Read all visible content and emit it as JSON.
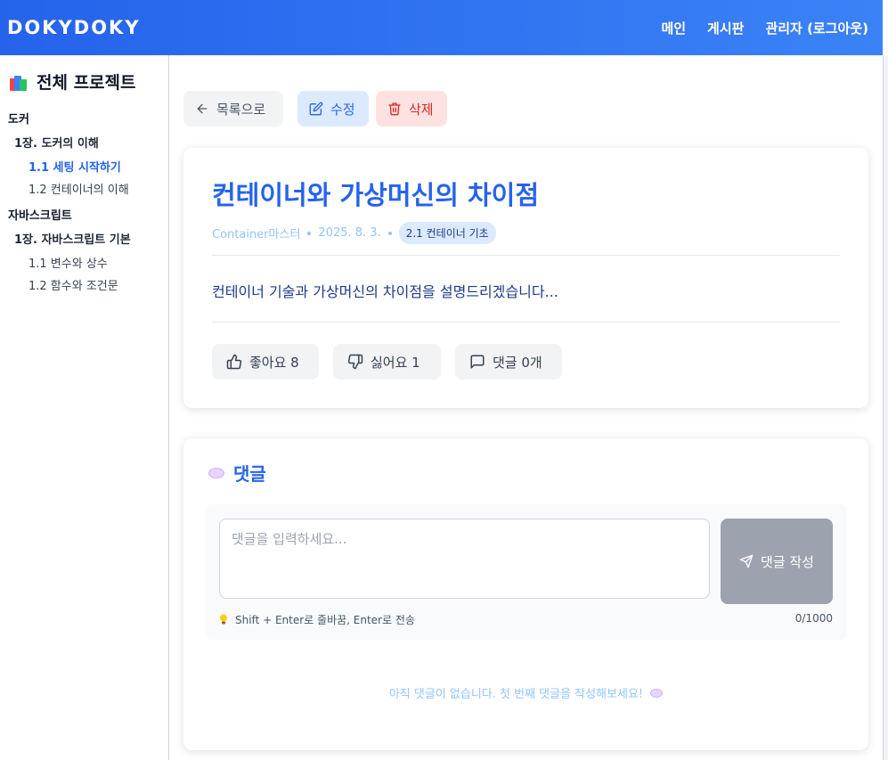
{
  "header": {
    "logo": "DOKYDOKY",
    "nav": [
      "메인",
      "게시판",
      "관리자 (로그아웃)"
    ]
  },
  "sidebar": {
    "title": "전체 프로젝트",
    "categories": [
      {
        "name": "도커",
        "chapter": "1장. 도커의 이해",
        "sections": [
          "1.1 세팅 시작하기",
          "1.2 컨테이너의 이해"
        ]
      },
      {
        "name": "자바스크립트",
        "chapter": "1장. 자바스크립트 기본",
        "sections": [
          "1.1 변수와 상수",
          "1.2 함수와 조건문"
        ]
      }
    ],
    "active_section": "1.1 세팅 시작하기"
  },
  "actions": {
    "back": "목록으로",
    "edit": "수정",
    "delete": "삭제"
  },
  "post": {
    "title": "컨테이너와 가상머신의 차이점",
    "author": "Container마스터",
    "date": "2025. 8. 3.",
    "tag": "2.1 컨테이너 기초",
    "content": "컨테이너 기술과 가상머신의 차이점을 설명드리겠습니다...",
    "like": "좋아요 8",
    "dislike": "싫어요 1",
    "comments": "댓글 0개"
  },
  "comments": {
    "title": "댓글",
    "placeholder": "댓글을 입력하세요...",
    "submit": "댓글 작성",
    "hint": "Shift + Enter로 줄바꿈, Enter로 전송",
    "count": "0/1000",
    "empty": "아직 댓글이 없습니다. 첫 번째 댓글을 작성해보세요!"
  },
  "colors": {
    "header_start": "#2563eb",
    "header_end": "#3b82f6",
    "accent": "#2563eb",
    "danger": "#dc2626"
  },
  "icons": [
    "books-icon",
    "arrow-left-icon",
    "edit-icon",
    "trash-icon",
    "thumbs-up-icon",
    "thumbs-down-icon",
    "comment-icon",
    "speech-bubble-icon",
    "send-icon",
    "lightbulb-icon"
  ]
}
